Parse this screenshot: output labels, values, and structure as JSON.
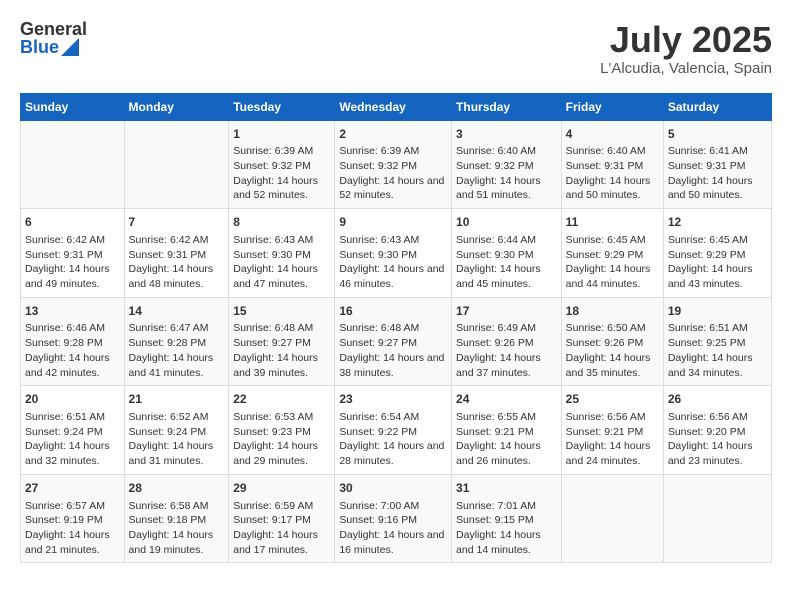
{
  "header": {
    "logo_general": "General",
    "logo_blue": "Blue",
    "title": "July 2025",
    "subtitle": "L'Alcudia, Valencia, Spain"
  },
  "calendar": {
    "days_of_week": [
      "Sunday",
      "Monday",
      "Tuesday",
      "Wednesday",
      "Thursday",
      "Friday",
      "Saturday"
    ],
    "weeks": [
      {
        "cells": [
          {
            "day": null,
            "content": ""
          },
          {
            "day": null,
            "content": ""
          },
          {
            "day": "1",
            "content": "Sunrise: 6:39 AM\nSunset: 9:32 PM\nDaylight: 14 hours and 52 minutes."
          },
          {
            "day": "2",
            "content": "Sunrise: 6:39 AM\nSunset: 9:32 PM\nDaylight: 14 hours and 52 minutes."
          },
          {
            "day": "3",
            "content": "Sunrise: 6:40 AM\nSunset: 9:32 PM\nDaylight: 14 hours and 51 minutes."
          },
          {
            "day": "4",
            "content": "Sunrise: 6:40 AM\nSunset: 9:31 PM\nDaylight: 14 hours and 50 minutes."
          },
          {
            "day": "5",
            "content": "Sunrise: 6:41 AM\nSunset: 9:31 PM\nDaylight: 14 hours and 50 minutes."
          }
        ]
      },
      {
        "cells": [
          {
            "day": "6",
            "content": "Sunrise: 6:42 AM\nSunset: 9:31 PM\nDaylight: 14 hours and 49 minutes."
          },
          {
            "day": "7",
            "content": "Sunrise: 6:42 AM\nSunset: 9:31 PM\nDaylight: 14 hours and 48 minutes."
          },
          {
            "day": "8",
            "content": "Sunrise: 6:43 AM\nSunset: 9:30 PM\nDaylight: 14 hours and 47 minutes."
          },
          {
            "day": "9",
            "content": "Sunrise: 6:43 AM\nSunset: 9:30 PM\nDaylight: 14 hours and 46 minutes."
          },
          {
            "day": "10",
            "content": "Sunrise: 6:44 AM\nSunset: 9:30 PM\nDaylight: 14 hours and 45 minutes."
          },
          {
            "day": "11",
            "content": "Sunrise: 6:45 AM\nSunset: 9:29 PM\nDaylight: 14 hours and 44 minutes."
          },
          {
            "day": "12",
            "content": "Sunrise: 6:45 AM\nSunset: 9:29 PM\nDaylight: 14 hours and 43 minutes."
          }
        ]
      },
      {
        "cells": [
          {
            "day": "13",
            "content": "Sunrise: 6:46 AM\nSunset: 9:28 PM\nDaylight: 14 hours and 42 minutes."
          },
          {
            "day": "14",
            "content": "Sunrise: 6:47 AM\nSunset: 9:28 PM\nDaylight: 14 hours and 41 minutes."
          },
          {
            "day": "15",
            "content": "Sunrise: 6:48 AM\nSunset: 9:27 PM\nDaylight: 14 hours and 39 minutes."
          },
          {
            "day": "16",
            "content": "Sunrise: 6:48 AM\nSunset: 9:27 PM\nDaylight: 14 hours and 38 minutes."
          },
          {
            "day": "17",
            "content": "Sunrise: 6:49 AM\nSunset: 9:26 PM\nDaylight: 14 hours and 37 minutes."
          },
          {
            "day": "18",
            "content": "Sunrise: 6:50 AM\nSunset: 9:26 PM\nDaylight: 14 hours and 35 minutes."
          },
          {
            "day": "19",
            "content": "Sunrise: 6:51 AM\nSunset: 9:25 PM\nDaylight: 14 hours and 34 minutes."
          }
        ]
      },
      {
        "cells": [
          {
            "day": "20",
            "content": "Sunrise: 6:51 AM\nSunset: 9:24 PM\nDaylight: 14 hours and 32 minutes."
          },
          {
            "day": "21",
            "content": "Sunrise: 6:52 AM\nSunset: 9:24 PM\nDaylight: 14 hours and 31 minutes."
          },
          {
            "day": "22",
            "content": "Sunrise: 6:53 AM\nSunset: 9:23 PM\nDaylight: 14 hours and 29 minutes."
          },
          {
            "day": "23",
            "content": "Sunrise: 6:54 AM\nSunset: 9:22 PM\nDaylight: 14 hours and 28 minutes."
          },
          {
            "day": "24",
            "content": "Sunrise: 6:55 AM\nSunset: 9:21 PM\nDaylight: 14 hours and 26 minutes."
          },
          {
            "day": "25",
            "content": "Sunrise: 6:56 AM\nSunset: 9:21 PM\nDaylight: 14 hours and 24 minutes."
          },
          {
            "day": "26",
            "content": "Sunrise: 6:56 AM\nSunset: 9:20 PM\nDaylight: 14 hours and 23 minutes."
          }
        ]
      },
      {
        "cells": [
          {
            "day": "27",
            "content": "Sunrise: 6:57 AM\nSunset: 9:19 PM\nDaylight: 14 hours and 21 minutes."
          },
          {
            "day": "28",
            "content": "Sunrise: 6:58 AM\nSunset: 9:18 PM\nDaylight: 14 hours and 19 minutes."
          },
          {
            "day": "29",
            "content": "Sunrise: 6:59 AM\nSunset: 9:17 PM\nDaylight: 14 hours and 17 minutes."
          },
          {
            "day": "30",
            "content": "Sunrise: 7:00 AM\nSunset: 9:16 PM\nDaylight: 14 hours and 16 minutes."
          },
          {
            "day": "31",
            "content": "Sunrise: 7:01 AM\nSunset: 9:15 PM\nDaylight: 14 hours and 14 minutes."
          },
          {
            "day": null,
            "content": ""
          },
          {
            "day": null,
            "content": ""
          }
        ]
      }
    ]
  }
}
